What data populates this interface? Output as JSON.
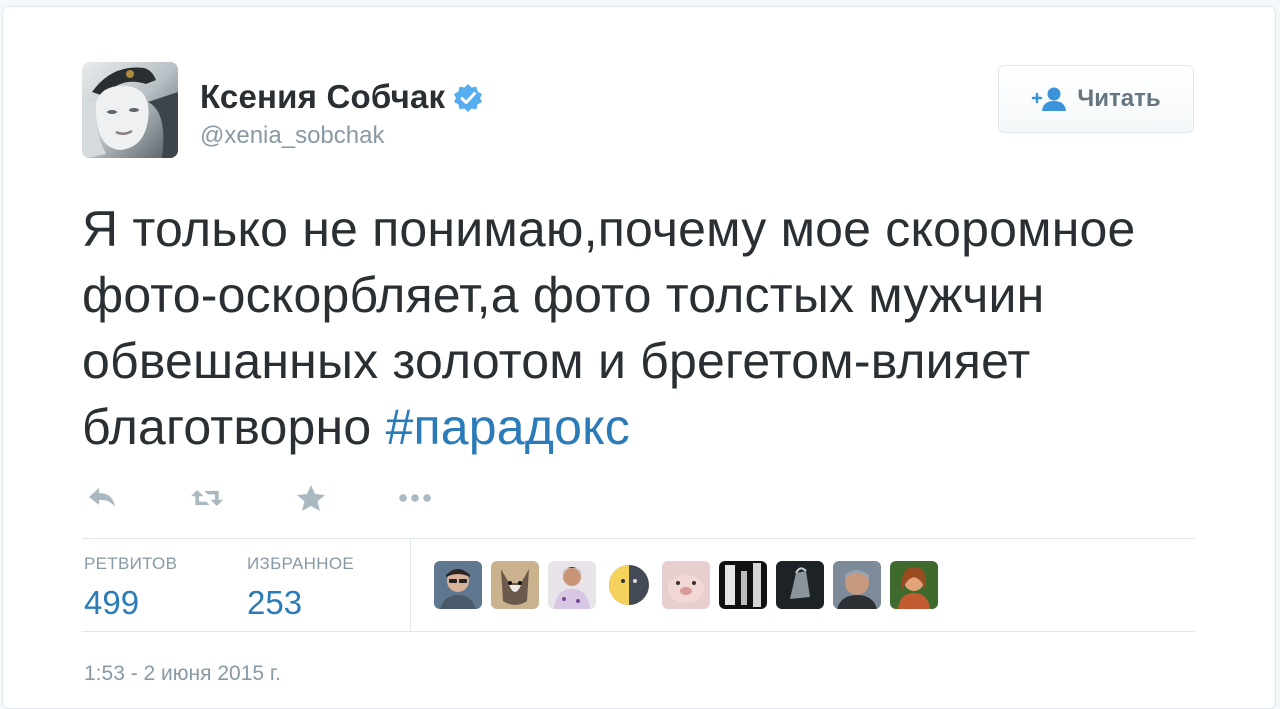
{
  "author": {
    "name": "Ксения Собчак",
    "handle": "@xenia_sobchak",
    "verified_icon": "verified-badge-icon",
    "avatar_icon": "profile-photo"
  },
  "follow_button": {
    "label": "Читать",
    "icon": "follow-user-icon"
  },
  "tweet": {
    "text": "Я только не понимаю,почему мое скоромное фото-оскорбляет,а фото толстых мужчин обвешанных золотом и брегетом-влияет благотворно ",
    "hashtag": "#парадокс"
  },
  "actions": [
    {
      "name": "reply",
      "icon": "reply-icon"
    },
    {
      "name": "retweet",
      "icon": "retweet-icon"
    },
    {
      "name": "favorite",
      "icon": "star-icon"
    },
    {
      "name": "more",
      "icon": "more-dots-icon"
    }
  ],
  "stats": {
    "retweets_label": "РЕТВИТОВ",
    "retweets_value": "499",
    "favorites_label": "ИЗБРАННОЕ",
    "favorites_value": "253"
  },
  "favorited_by_count_shown": 9,
  "timestamp": "1:53 - 2 июня 2015 г.",
  "colors": {
    "link": "#2b7bb9",
    "text": "#292f33",
    "muted": "#8899a6",
    "border": "#e1e8ed",
    "verified": "#55acee"
  }
}
